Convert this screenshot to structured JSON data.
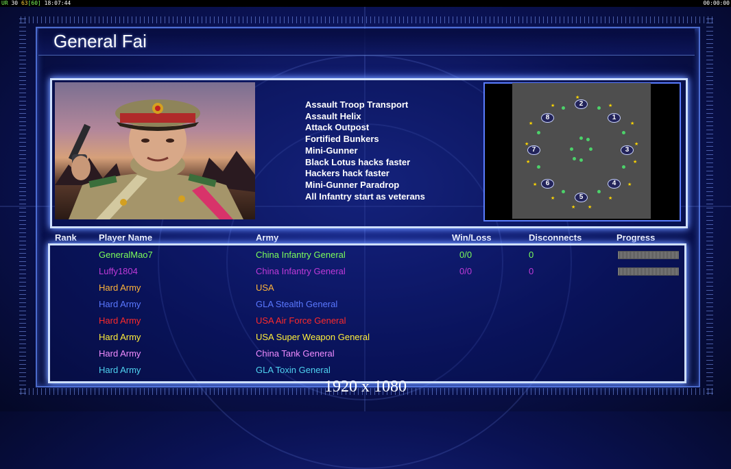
{
  "debug_bar": {
    "left_a": "UR",
    "left_b": "30",
    "left_c": "63",
    "left_d": "[60]",
    "left_time": "18:07:44",
    "right_time": "00:00:00"
  },
  "title": "General Fai",
  "upgrades": [
    "Assault Troop Transport",
    "Assault Helix",
    "Attack Outpost",
    "Fortified Bunkers",
    "Mini-Gunner",
    "Black Lotus hacks faster",
    "Hackers hack faster",
    "Mini-Gunner Paradrop",
    "All Infantry start as veterans"
  ],
  "map": {
    "slots": [
      "1",
      "2",
      "3",
      "4",
      "5",
      "6",
      "7",
      "8"
    ]
  },
  "table": {
    "headers": {
      "rank": "Rank",
      "player": "Player Name",
      "army": "Army",
      "winloss": "Win/Loss",
      "disconnects": "Disconnects",
      "progress": "Progress"
    },
    "rows": [
      {
        "player": "GeneralMao7",
        "army": "China Infantry General",
        "winloss": "0/0",
        "disconnects": "0",
        "color": "#7cff5a",
        "has_progress": true
      },
      {
        "player": "Luffy1804",
        "army": "China Infantry General",
        "winloss": "0/0",
        "disconnects": "0",
        "color": "#c03ad8",
        "has_progress": true
      },
      {
        "player": "Hard Army",
        "army": "USA",
        "winloss": "",
        "disconnects": "",
        "color": "#ffb43a",
        "has_progress": false
      },
      {
        "player": "Hard Army",
        "army": "GLA Stealth General",
        "winloss": "",
        "disconnects": "",
        "color": "#5a78ff",
        "has_progress": false
      },
      {
        "player": "Hard Army",
        "army": "USA Air Force General",
        "winloss": "",
        "disconnects": "",
        "color": "#ff2a2a",
        "has_progress": false
      },
      {
        "player": "Hard Army",
        "army": "USA Super Weapon General",
        "winloss": "",
        "disconnects": "",
        "color": "#ffee3a",
        "has_progress": false
      },
      {
        "player": "Hard Army",
        "army": "China Tank General",
        "winloss": "",
        "disconnects": "",
        "color": "#f08cff",
        "has_progress": false
      },
      {
        "player": "Hard Army",
        "army": "GLA Toxin General",
        "winloss": "",
        "disconnects": "",
        "color": "#4fd2f0",
        "has_progress": false
      }
    ]
  },
  "resolution_label": "1920 x 1080"
}
